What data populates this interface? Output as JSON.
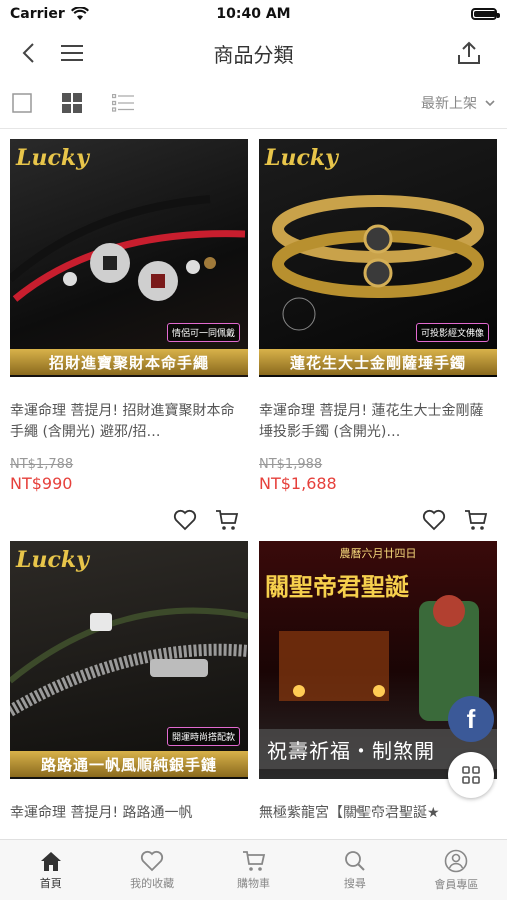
{
  "status": {
    "carrier": "Carrier",
    "time": "10:40 AM"
  },
  "header": {
    "title": "商品分類"
  },
  "toolbar": {
    "sort_label": "最新上架"
  },
  "products": [
    {
      "name": "幸運命理 菩提月! 招財進寶聚財本命手繩 (含開光) 避邪/招…",
      "original_price": "NT$1,788",
      "price": "NT$990",
      "banner": "招財進寶聚財本命手繩",
      "tag": "情侶可一同佩戴",
      "logo": "Lucky"
    },
    {
      "name": "幸運命理 菩提月! 蓮花生大士金剛薩埵投影手鐲 (含開光)…",
      "original_price": "NT$1,988",
      "price": "NT$1,688",
      "banner": "蓮花生大士金剛薩埵手鐲",
      "tag": "可投影經文佛像",
      "logo": "Lucky"
    },
    {
      "name": "幸運命理 菩提月! 路路通一帆",
      "banner": "路路通一帆風順純銀手鏈",
      "tag": "開運時尚搭配款",
      "logo": "Lucky"
    },
    {
      "name": "無極紫龍宮【關聖帝君聖誕★",
      "banner_top": "農曆六月廿四日",
      "headline": "關聖帝君聖誕",
      "banner": "祝壽祈福・制煞開"
    }
  ],
  "tabbar": [
    {
      "label": "首頁",
      "icon": "home-icon"
    },
    {
      "label": "我的收藏",
      "icon": "heart-icon"
    },
    {
      "label": "購物車",
      "icon": "cart-icon"
    },
    {
      "label": "搜尋",
      "icon": "search-icon"
    },
    {
      "label": "會員專區",
      "icon": "user-icon"
    }
  ],
  "colors": {
    "accent": "#e6403b",
    "facebook": "#3b5998"
  }
}
